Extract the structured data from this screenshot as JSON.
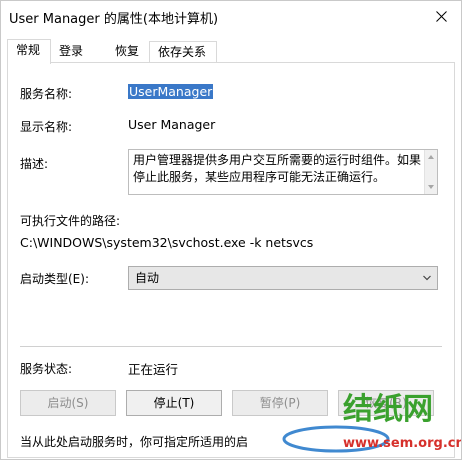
{
  "window": {
    "title": "User Manager 的属性(本地计算机)"
  },
  "tabs": [
    {
      "label": "常规",
      "active": true
    },
    {
      "label": "登录",
      "active": false
    },
    {
      "label": "恢复",
      "active": false
    },
    {
      "label": "依存关系",
      "active": false
    }
  ],
  "general": {
    "service_name_label": "服务名称:",
    "service_name_value": "UserManager",
    "display_name_label": "显示名称:",
    "display_name_value": "User Manager",
    "description_label": "描述:",
    "description_value": "用户管理器提供多用户交互所需要的运行时组件。如果停止此服务，某些应用程序可能无法正确运行。",
    "path_label": "可执行文件的路径:",
    "path_value": "C:\\WINDOWS\\system32\\svchost.exe -k netsvcs",
    "startup_type_label": "启动类型(E):",
    "startup_type_value": "自动",
    "status_label": "服务状态:",
    "status_value": "正在运行",
    "buttons": {
      "start": "启动(S)",
      "stop": "停止(T)",
      "pause": "暂停(P)",
      "resume": "恢复(R)"
    },
    "footer_text": "当从此处启动服务时，你可指定所适用的启"
  },
  "watermark": {
    "text": "结纸网",
    "url": "www.sem.org.cn",
    "colors": {
      "green": "#3aa12e",
      "red": "#d6302b",
      "blue": "#1f74c8"
    }
  }
}
